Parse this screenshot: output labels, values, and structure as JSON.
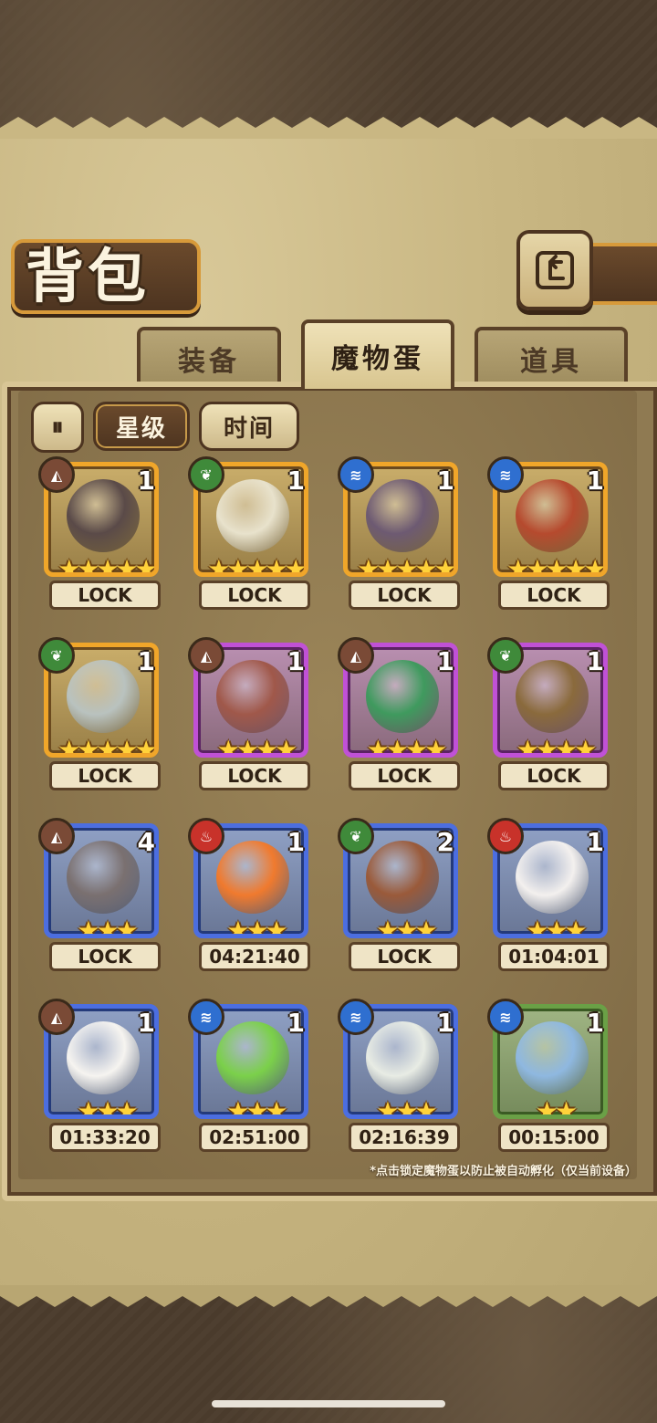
{
  "header": {
    "title": "背包",
    "back_icon": "back-arrow-icon"
  },
  "tabs": [
    {
      "label": "装备",
      "active": false
    },
    {
      "label": "魔物蛋",
      "active": true
    },
    {
      "label": "道具",
      "active": false
    }
  ],
  "sort": {
    "toggle_icon": "pause-sort-icon",
    "toggle_label": "⏸",
    "options": [
      {
        "label": "星级",
        "active": true
      },
      {
        "label": "时间",
        "active": false
      }
    ]
  },
  "eggs": [
    {
      "element": "earth",
      "elem_glyph": "◭",
      "count": "1",
      "stars": "★★★★★",
      "frame": "gold",
      "label": "LOCK",
      "color": "#5a4a48"
    },
    {
      "element": "wood",
      "elem_glyph": "❦",
      "count": "1",
      "stars": "★★★★★",
      "frame": "gold",
      "label": "LOCK",
      "color": "#e8e2cc"
    },
    {
      "element": "water",
      "elem_glyph": "≋",
      "count": "1",
      "stars": "★★★★★",
      "frame": "gold",
      "label": "LOCK",
      "color": "#6d5a72"
    },
    {
      "element": "water",
      "elem_glyph": "≋",
      "count": "1",
      "stars": "★★★★★",
      "frame": "gold",
      "label": "LOCK",
      "color": "#b64a2e"
    },
    {
      "element": "wood",
      "elem_glyph": "❦",
      "count": "1",
      "stars": "★★★★★",
      "frame": "gold",
      "label": "LOCK",
      "color": "#b9c2bf"
    },
    {
      "element": "earth",
      "elem_glyph": "◭",
      "count": "1",
      "stars": "★★★★",
      "frame": "purple",
      "label": "LOCK",
      "color": "#a0584a"
    },
    {
      "element": "earth",
      "elem_glyph": "◭",
      "count": "1",
      "stars": "★★★★",
      "frame": "purple",
      "label": "LOCK",
      "color": "#3f9a5e"
    },
    {
      "element": "wood",
      "elem_glyph": "❦",
      "count": "1",
      "stars": "★★★★",
      "frame": "purple",
      "label": "LOCK",
      "color": "#8a6a3c"
    },
    {
      "element": "earth",
      "elem_glyph": "◭",
      "count": "4",
      "stars": "★★★",
      "frame": "blue",
      "label": "LOCK",
      "color": "#7a7070"
    },
    {
      "element": "fire",
      "elem_glyph": "♨",
      "count": "1",
      "stars": "★★★",
      "frame": "blue",
      "label": "04:21:40",
      "color": "#f07a2e"
    },
    {
      "element": "wood",
      "elem_glyph": "❦",
      "count": "2",
      "stars": "★★★",
      "frame": "blue",
      "label": "LOCK",
      "color": "#9a5a3a"
    },
    {
      "element": "fire",
      "elem_glyph": "♨",
      "count": "1",
      "stars": "★★★",
      "frame": "blue",
      "label": "01:04:01",
      "color": "#f3f0ee"
    },
    {
      "element": "earth",
      "elem_glyph": "◭",
      "count": "1",
      "stars": "★★★",
      "frame": "blue",
      "label": "01:33:20",
      "color": "#f6f4f0"
    },
    {
      "element": "water",
      "elem_glyph": "≋",
      "count": "1",
      "stars": "★★★",
      "frame": "blue",
      "label": "02:51:00",
      "color": "#7bd04a"
    },
    {
      "element": "water",
      "elem_glyph": "≋",
      "count": "1",
      "stars": "★★★",
      "frame": "blue",
      "label": "02:16:39",
      "color": "#e8ece4"
    },
    {
      "element": "water",
      "elem_glyph": "≋",
      "count": "1",
      "stars": "★★",
      "frame": "green",
      "label": "00:15:00",
      "color": "#8fb8e0"
    }
  ],
  "hint": "*点击锁定魔物蛋以防止被自动孵化（仅当前设备）"
}
